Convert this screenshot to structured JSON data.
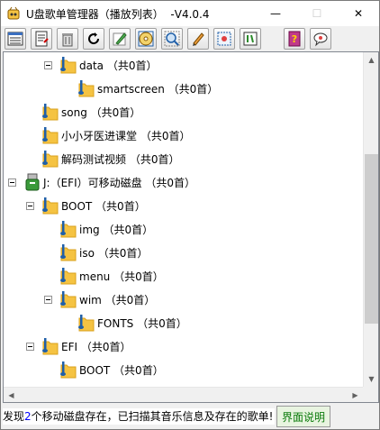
{
  "window": {
    "title": "U盘歌单管理器（播放列表）  -V4.0.4",
    "minimize_glyph": "—",
    "maximize_glyph": "☐",
    "close_glyph": "✕"
  },
  "toolbar": {
    "buttons": [
      {
        "name": "list-view-icon"
      },
      {
        "name": "edit-document-icon"
      },
      {
        "name": "trash-icon"
      },
      {
        "name": "refresh-icon"
      },
      {
        "name": "pencil-edit-icon"
      },
      {
        "name": "music-disk-icon"
      },
      {
        "name": "scan-icon"
      },
      {
        "name": "draw-icon"
      },
      {
        "name": "select-area-icon"
      },
      {
        "name": "script-icon"
      },
      {
        "name": "help-book-icon"
      },
      {
        "name": "chat-icon"
      }
    ]
  },
  "tree": {
    "nodes": [
      {
        "label": "data （共0首）"
      },
      {
        "label": "smartscreen （共0首）"
      },
      {
        "label": "song （共0首）"
      },
      {
        "label": "小小牙医进课堂 （共0首）"
      },
      {
        "label": "解码测试视频 （共0首）"
      },
      {
        "label": "J:（EFI）可移动磁盘 （共0首）"
      },
      {
        "label": "BOOT （共0首）"
      },
      {
        "label": "img （共0首）"
      },
      {
        "label": "iso （共0首）"
      },
      {
        "label": "menu （共0首）"
      },
      {
        "label": "wim （共0首）"
      },
      {
        "label": "FONTS （共0首）"
      },
      {
        "label": "EFI （共0首）"
      },
      {
        "label": "BOOT （共0首）"
      }
    ]
  },
  "status": {
    "prefix": "发现",
    "count": "2",
    "message": "个移动磁盘存在，已扫描其音乐信息及存在的歌单!",
    "help_button": "界面说明"
  },
  "colors": {
    "folder": "#f5c342",
    "folder_dark": "#d9a21c",
    "music_note": "#1f5fa8",
    "count_highlight": "#0000ff",
    "help_text": "#0a7a0a"
  }
}
